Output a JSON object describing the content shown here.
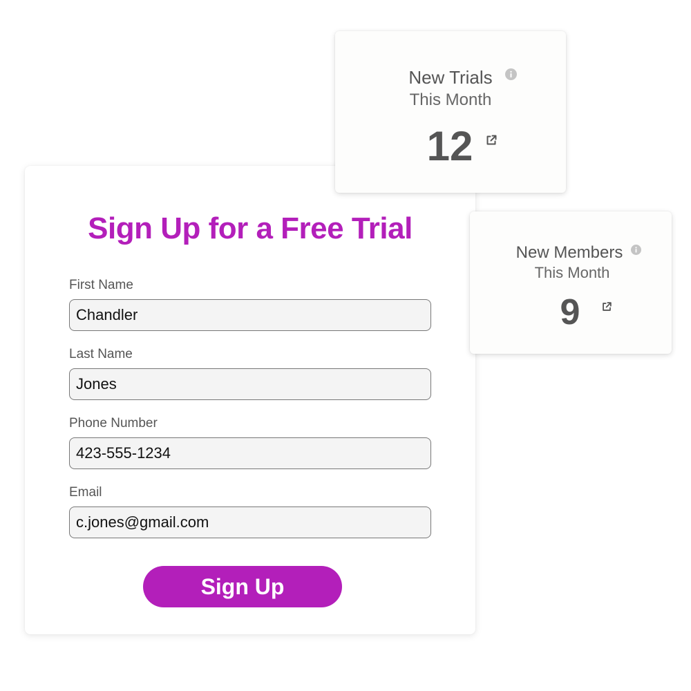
{
  "signup_form": {
    "title": "Sign Up for a Free Trial",
    "fields": [
      {
        "label": "First Name",
        "value": "Chandler"
      },
      {
        "label": "Last Name",
        "value": "Jones"
      },
      {
        "label": "Phone Number",
        "value": "423-555-1234"
      },
      {
        "label": "Email",
        "value": "c.jones@gmail.com"
      }
    ],
    "submit_label": "Sign Up"
  },
  "stat_cards": [
    {
      "title": "New Trials",
      "subtitle": "This Month",
      "value": "12",
      "icons": [
        "info-icon",
        "external-link-icon"
      ]
    },
    {
      "title": "New Members",
      "subtitle": "This Month",
      "value": "9",
      "icons": [
        "info-icon",
        "external-link-icon"
      ]
    }
  ],
  "colors": {
    "brand": "#b31fba",
    "text_muted": "#555555",
    "input_bg": "#f4f4f4",
    "icon_gray": "#c4c4c4",
    "card_bg": "#fdfdfc"
  }
}
